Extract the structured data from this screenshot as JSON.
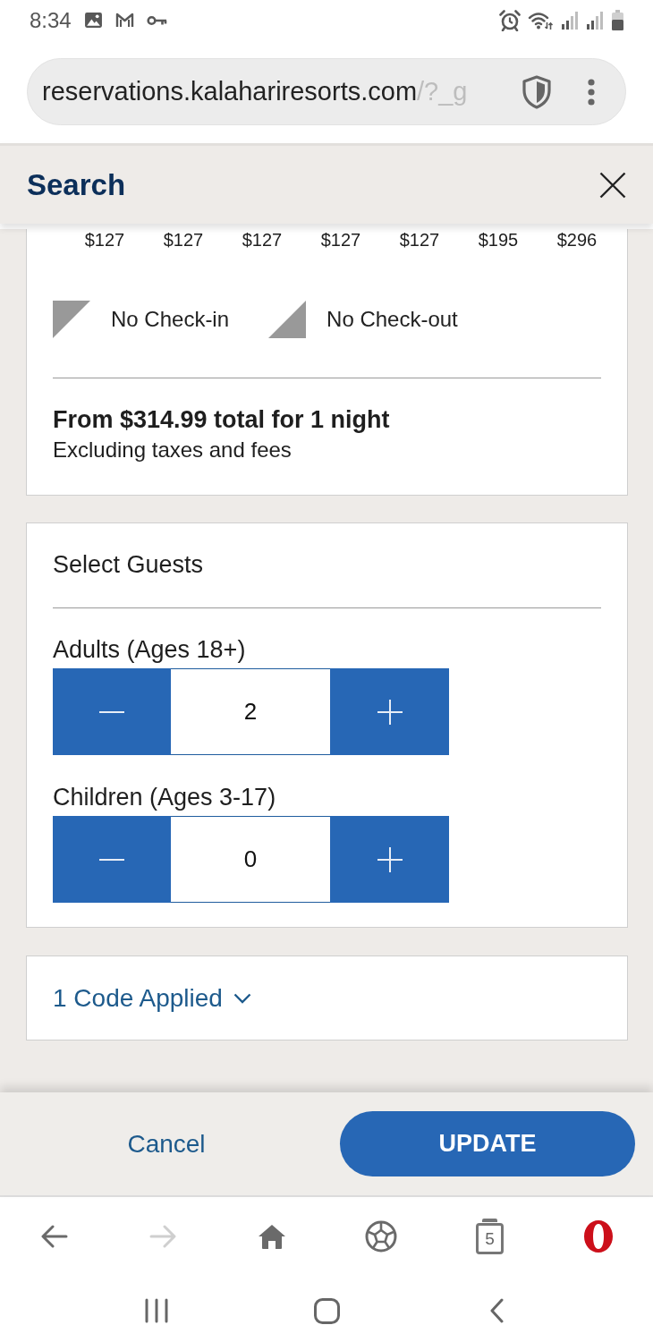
{
  "status_bar": {
    "time": "8:34"
  },
  "browser": {
    "url_host": "reservations.kalahariresorts.com",
    "url_path": "/?_g"
  },
  "header": {
    "title": "Search"
  },
  "calendar": {
    "prices": [
      "$127",
      "$127",
      "$127",
      "$127",
      "$127",
      "$195",
      "$296"
    ],
    "legend": [
      {
        "kind": "no_checkin",
        "label": "No Check-in"
      },
      {
        "kind": "no_checkout",
        "label": "No Check-out"
      }
    ],
    "total": "From $314.99 total for 1 night",
    "note": "Excluding taxes and fees"
  },
  "guests": {
    "title": "Select Guests",
    "counters": [
      {
        "label": "Adults (Ages 18+)",
        "value": "2"
      },
      {
        "label": "Children (Ages 3-17)",
        "value": "0"
      }
    ]
  },
  "promo": {
    "label": "1 Code Applied",
    "expanded": false
  },
  "actions": {
    "cancel": "Cancel",
    "update": "UPDATE"
  },
  "toolbar": [
    {
      "kind": "back",
      "disabled": false
    },
    {
      "kind": "forward",
      "disabled": true
    },
    {
      "kind": "home",
      "disabled": false
    },
    {
      "kind": "ball",
      "disabled": false
    },
    {
      "kind": "tabs",
      "label": "5",
      "disabled": false
    },
    {
      "kind": "logo",
      "disabled": false
    }
  ]
}
